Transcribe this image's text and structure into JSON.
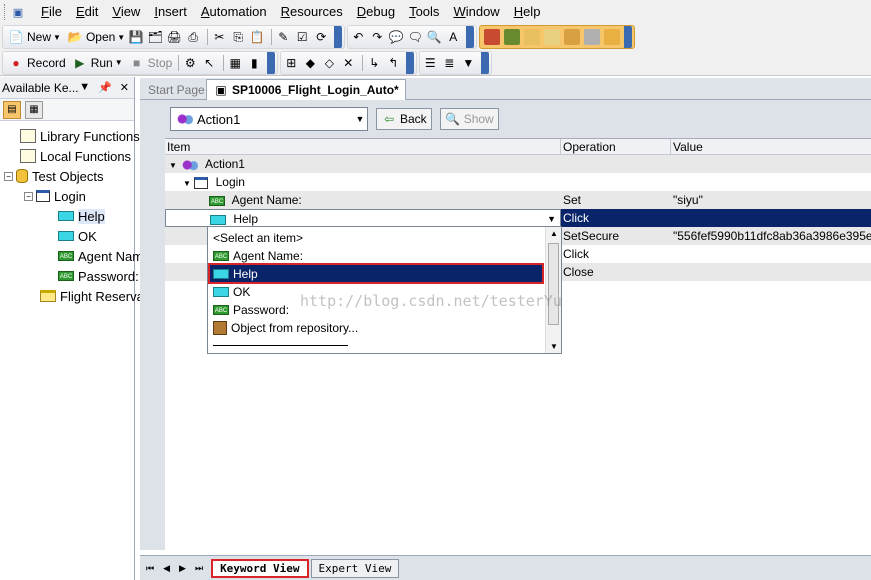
{
  "menu": [
    "File",
    "Edit",
    "View",
    "Insert",
    "Automation",
    "Resources",
    "Debug",
    "Tools",
    "Window",
    "Help"
  ],
  "menu_mnemonics": [
    "F",
    "E",
    "V",
    "I",
    "A",
    "R",
    "D",
    "T",
    "W",
    "H"
  ],
  "toolbar": {
    "new_label": "New",
    "open_label": "Open",
    "record_label": "Record",
    "run_label": "Run",
    "stop_label": "Stop"
  },
  "left_panel": {
    "title": "Available Ke...",
    "tree": [
      {
        "label": "Library Functions",
        "icon": "library-icon"
      },
      {
        "label": "Local Functions",
        "icon": "library-icon"
      },
      {
        "label": "Test Objects",
        "icon": "database-icon"
      },
      {
        "label": "Login",
        "icon": "dialog-icon"
      },
      {
        "label": "Help",
        "icon": "winbutton-icon"
      },
      {
        "label": "OK",
        "icon": "winbutton-icon"
      },
      {
        "label": "Agent Name:",
        "icon": "wintextbox-icon"
      },
      {
        "label": "Password:",
        "icon": "wintextbox-icon"
      },
      {
        "label": "Flight Reservation",
        "icon": "window-icon"
      }
    ]
  },
  "tabs": {
    "start_page": "Start Page",
    "active_doc": "SP10006_Flight_Login_Auto*"
  },
  "action_bar": {
    "selected_action": "Action1",
    "back_label": "Back",
    "show_label": "Show"
  },
  "grid": {
    "columns": [
      "Item",
      "Operation",
      "Value"
    ],
    "rows": [
      {
        "item": "Action1",
        "operation": "",
        "value": ""
      },
      {
        "item": "Login",
        "operation": "",
        "value": ""
      },
      {
        "item": "Agent Name:",
        "operation": "Set",
        "value": "\"siyu\""
      },
      {
        "item": "Help",
        "operation": "Click",
        "value": ""
      },
      {
        "item": "",
        "operation": "SetSecure",
        "value": "\"556fef5990b11dfc8ab36a3986e395e..."
      },
      {
        "item": "",
        "operation": "Click",
        "value": ""
      },
      {
        "item": "",
        "operation": "Close",
        "value": ""
      }
    ]
  },
  "dropdown": {
    "items": [
      {
        "label": "<Select an item>",
        "icon": ""
      },
      {
        "label": "Agent Name:",
        "icon": "wintextbox-icon"
      },
      {
        "label": "Help",
        "icon": "winbutton-icon"
      },
      {
        "label": "OK",
        "icon": "winbutton-icon"
      },
      {
        "label": "Password:",
        "icon": "wintextbox-icon"
      },
      {
        "label": "Object from repository...",
        "icon": "repository-icon"
      }
    ],
    "selected": "Help"
  },
  "watermark": "http://blog.csdn.net/testerYu",
  "bottom_tabs": {
    "keyword_view": "Keyword View",
    "expert_view": "Expert View"
  },
  "colors": {
    "selection": "#0a246a",
    "highlight_border": "#d9252a",
    "chrome": "#f0f0f0",
    "panel": "#dde1e8"
  }
}
